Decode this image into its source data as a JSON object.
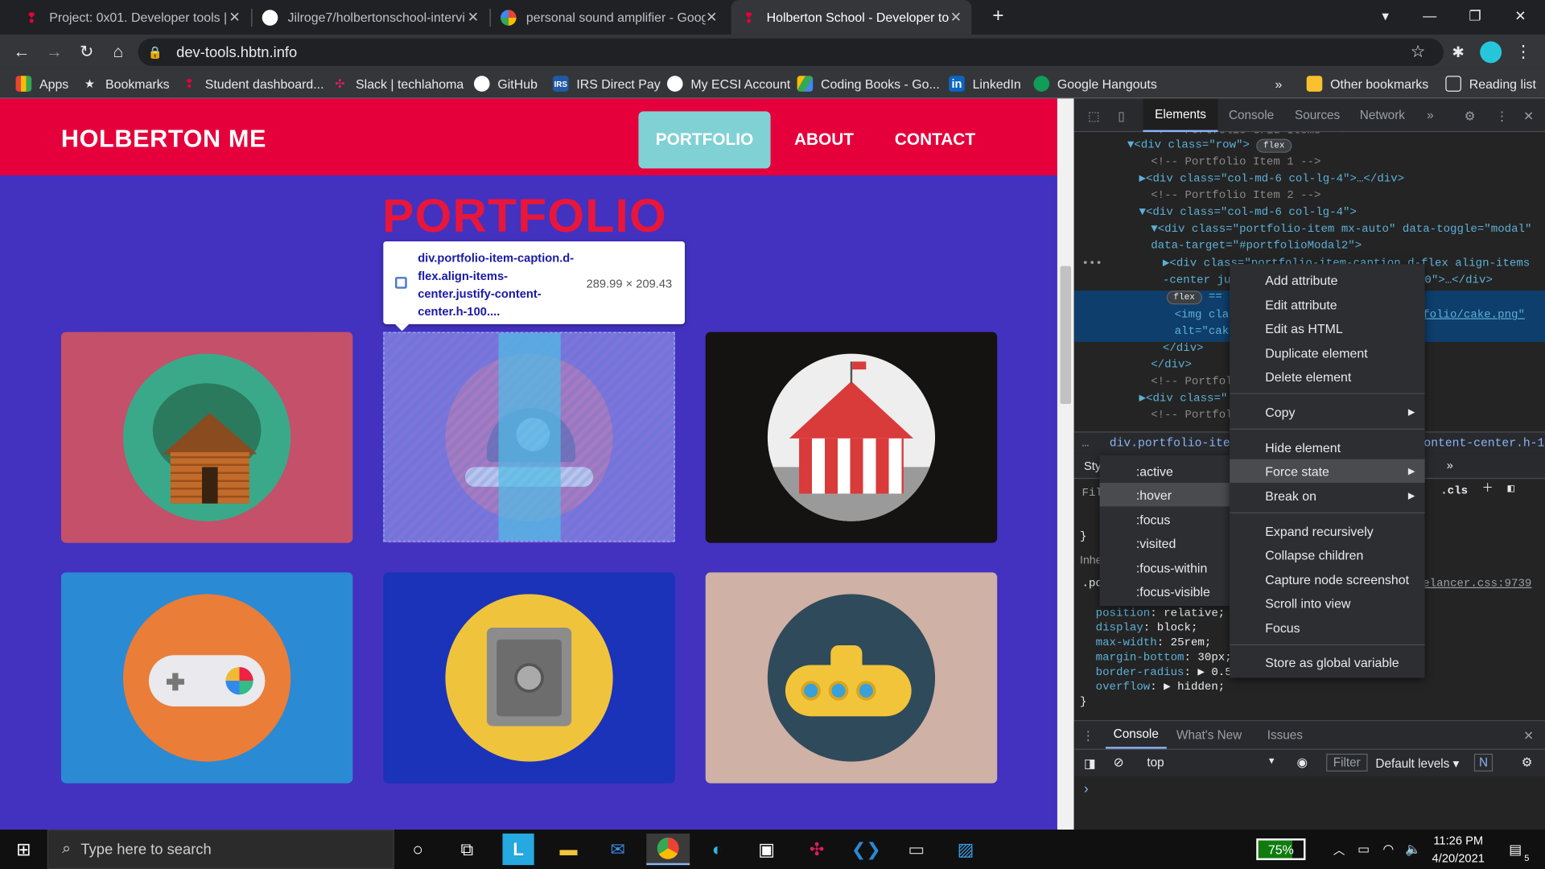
{
  "tabs": [
    {
      "title": "Project: 0x01. Developer tools | H",
      "icon_color": "#e6003b",
      "close": "✕"
    },
    {
      "title": "Jilroge7/holbertonschool-intervi",
      "icon_color": "#ffffff",
      "close": "✕"
    },
    {
      "title": "personal sound amplifier - Googl",
      "icon_color": "#4285f4",
      "close": "✕"
    },
    {
      "title": "Holberton School - Developer to",
      "icon_color": "#e6003b",
      "close": "✕"
    }
  ],
  "new_tab": "+",
  "window_controls": {
    "profile_menu": "▾",
    "minimize": "—",
    "restore": "❐",
    "close": "✕"
  },
  "toolbar": {
    "back": "←",
    "forward": "→",
    "reload": "↻",
    "home": "⌂",
    "lock": "🔒",
    "url": "dev-tools.hbtn.info",
    "star": "☆",
    "menu": "⋮"
  },
  "bookmarks": {
    "items": [
      {
        "label": "Apps",
        "icon": "apps-grid-icon"
      },
      {
        "label": "Bookmarks",
        "icon": "star-icon"
      },
      {
        "label": "Student dashboard...",
        "icon": "holberton-icon"
      },
      {
        "label": "Slack | techlahoma",
        "icon": "slack-icon"
      },
      {
        "label": "GitHub",
        "icon": "github-icon"
      },
      {
        "label": "IRS Direct Pay",
        "icon": "irs-icon"
      },
      {
        "label": "My ECSI Account",
        "icon": "ecsi-icon"
      },
      {
        "label": "Coding Books - Go...",
        "icon": "drive-icon"
      },
      {
        "label": "LinkedIn",
        "icon": "linkedin-icon"
      },
      {
        "label": "Google Hangouts",
        "icon": "hangouts-icon"
      }
    ],
    "overflow": "»",
    "other": "Other bookmarks",
    "reading_list": "Reading list"
  },
  "site": {
    "brand": "HOLBERTON ME",
    "nav": [
      "PORTFOLIO",
      "ABOUT",
      "CONTACT"
    ],
    "section_title": "PORTFOLIO",
    "cards": [
      {
        "name": "cabin",
        "bg": "#c4506a",
        "circle": "#3aa98a"
      },
      {
        "name": "cake",
        "bg": "#6a40c9",
        "circle": "#b54a9a"
      },
      {
        "name": "circus",
        "bg": "#151212",
        "circle": "#eeeeee"
      },
      {
        "name": "game",
        "bg": "#2a8ad4",
        "circle": "#ea7d38"
      },
      {
        "name": "safe",
        "bg": "#1a33b8",
        "circle": "#f0c33c"
      },
      {
        "name": "submarine",
        "bg": "#cfb1a5",
        "circle": "#2f4a5b"
      }
    ],
    "inspect_tooltip": {
      "selector": "div.portfolio-item-caption.d-flex.align-items-center.justify-content-center.h-100....",
      "size": "289.99 × 209.43"
    }
  },
  "devtools": {
    "tabs": [
      "Elements",
      "Console",
      "Sources",
      "Network",
      "»"
    ],
    "dom_lines": [
      {
        "text": "<!-- Portfolio Grid Items -->",
        "type": "comment"
      },
      {
        "text": "▼<div class=\"row\">",
        "pill": "flex"
      },
      {
        "text": "<!-- Portfolio Item 1 -->",
        "type": "comment"
      },
      {
        "text": "▶<div class=\"col-md-6 col-lg-4\">…</div>"
      },
      {
        "text": "<!-- Portfolio Item 2 -->",
        "type": "comment"
      },
      {
        "text": "▼<div class=\"col-md-6 col-lg-4\">"
      },
      {
        "text": "▼<div class=\"portfolio-item mx-auto\" data-toggle=\"modal\""
      },
      {
        "text": "data-target=\"#portfolioModal2\">"
      },
      {
        "text": "▶<div class=\"portfolio-item-caption d-flex align-items"
      },
      {
        "text": "-center ju",
        "tail": "100\">…</div>"
      },
      {
        "text": "== $0",
        "pill": "flex"
      },
      {
        "text": "<img cla",
        "tail": "folio/cake.png\""
      },
      {
        "text": "alt=\"cak"
      },
      {
        "text": "</div>"
      },
      {
        "text": "</div>"
      },
      {
        "text": "<!-- Portfol",
        "type": "comment"
      },
      {
        "text": "▶<div class=\""
      },
      {
        "text": "<!-- Portfol",
        "type": "comment"
      }
    ],
    "breadcrumb": "div.portfolio-item-capt",
    "breadcrumb_tail": "ontent-center.h-1",
    "styles_tab": "Sty",
    "filter": "Filt",
    "hov_cls": ".cls",
    "inherited": "Inhe",
    "rule_selector": ".po",
    "rule_source": "elancer.css:9739",
    "props": [
      {
        "name": "position",
        "value": "relative;"
      },
      {
        "name": "display",
        "value": "block;"
      },
      {
        "name": "max-width",
        "value": "25rem;"
      },
      {
        "name": "margin-bottom",
        "value": "30px;"
      },
      {
        "name": "border-radius",
        "value": "▶ 0.5r"
      },
      {
        "name": "overflow",
        "value": "▶ hidden;"
      }
    ],
    "brace_close": "}",
    "drawer_tabs": [
      "Console",
      "What's New",
      "Issues"
    ],
    "console_context": "top",
    "console_filter": "Filter",
    "default_levels": "Default levels ▾",
    "issues_badge": "N",
    "prompt": "›"
  },
  "context_menu": {
    "items": [
      "Add attribute",
      "Edit attribute",
      "Edit as HTML",
      "Duplicate element",
      "Delete element",
      "Copy",
      "Hide element",
      "Force state",
      "Break on",
      "Expand recursively",
      "Collapse children",
      "Capture node screenshot",
      "Scroll into view",
      "Focus",
      "Store as global variable"
    ],
    "arrow": "▶"
  },
  "force_state_menu": {
    "items": [
      ":active",
      ":hover",
      ":focus",
      ":visited",
      ":focus-within",
      ":focus-visible"
    ],
    "highlighted": ":hover"
  },
  "taskbar": {
    "search_placeholder": "Type here to search",
    "battery": "75%",
    "time": "11:26 PM",
    "date": "4/20/2021",
    "notifications": "5"
  }
}
